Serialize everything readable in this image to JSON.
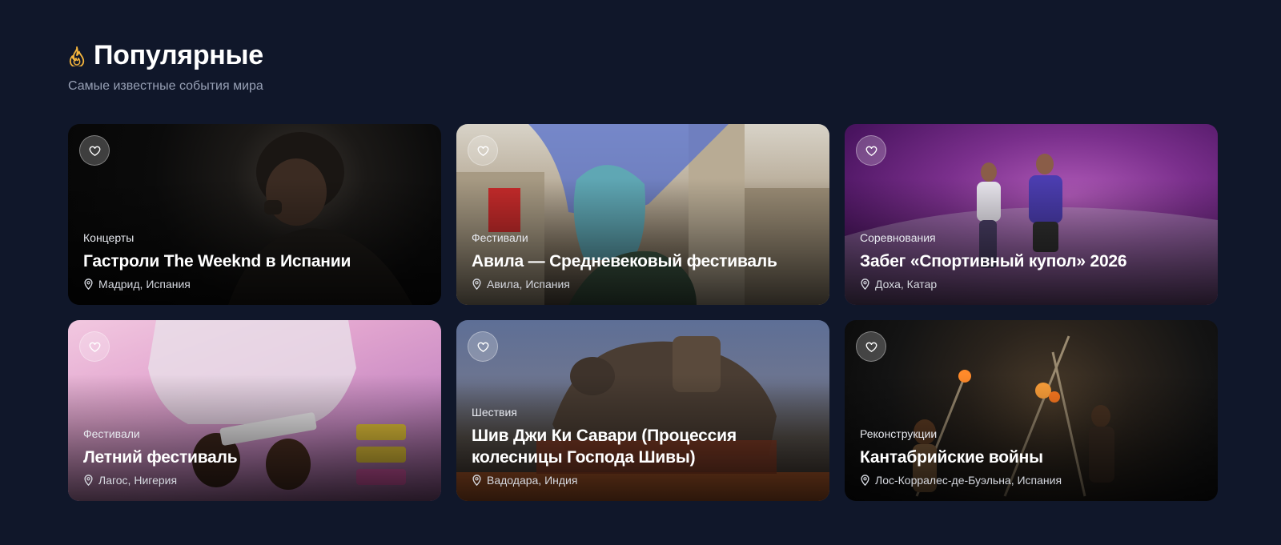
{
  "section": {
    "title": "Популярные",
    "subtitle": "Самые известные события мира",
    "icon": "fire-icon",
    "accent_color": "#f5b53d"
  },
  "events": [
    {
      "category": "Концерты",
      "title": "Гастроли The Weeknd в Испании",
      "location": "Мадрид, Испания"
    },
    {
      "category": "Фестивали",
      "title": "Авила — Средневековый фестиваль",
      "location": "Авила, Испания"
    },
    {
      "category": "Соревнования",
      "title": "Забег «Спортивный купол» 2026",
      "location": "Доха, Катар"
    },
    {
      "category": "Фестивали",
      "title": "Летний фестиваль",
      "location": "Лагос, Нигерия"
    },
    {
      "category": "Шествия",
      "title": "Шив Джи Ки Савари (Процессия колесницы Господа Шивы)",
      "location": "Вадодара, Индия"
    },
    {
      "category": "Реконструкции",
      "title": "Кантабрийские войны",
      "location": "Лос-Корралес-де-Буэльна, Испания"
    }
  ]
}
